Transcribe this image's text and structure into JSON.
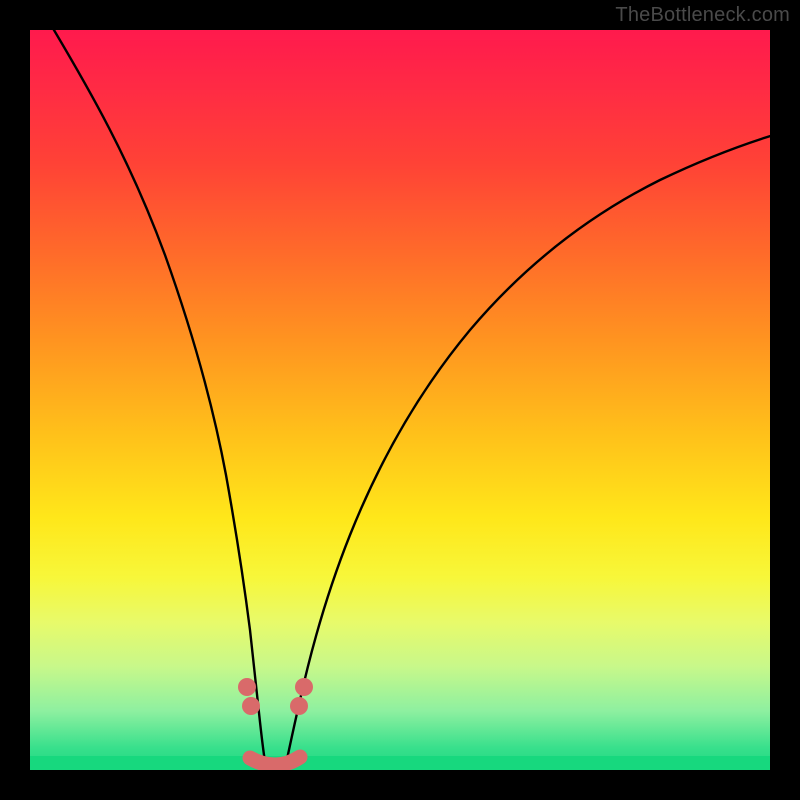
{
  "watermark": "TheBottleneck.com",
  "chart_data": {
    "type": "line",
    "title": "",
    "xlabel": "",
    "ylabel": "",
    "xlim": [
      0,
      10
    ],
    "ylim": [
      0,
      10
    ],
    "grid": false,
    "background_gradient": {
      "top_color": "#ff1a4d",
      "mid_colors": [
        "#ff6a2a",
        "#ffc21a",
        "#f7f73a"
      ],
      "bottom_color": "#17d87e",
      "orientation": "vertical"
    },
    "series": [
      {
        "name": "left-curve",
        "x": [
          0.2,
          0.6,
          1.0,
          1.4,
          1.8,
          2.05,
          2.28,
          2.45,
          2.58,
          2.66,
          2.72,
          2.78,
          2.86,
          2.92
        ],
        "values": [
          10.0,
          9.2,
          8.2,
          7.0,
          5.5,
          4.2,
          3.0,
          2.0,
          1.3,
          0.85,
          0.55,
          0.35,
          0.18,
          0.09
        ]
      },
      {
        "name": "right-curve",
        "x": [
          3.1,
          3.2,
          3.3,
          3.45,
          3.65,
          3.95,
          4.3,
          4.8,
          5.4,
          6.1,
          6.9,
          7.8,
          8.8,
          9.9,
          10.0
        ],
        "values": [
          0.09,
          0.2,
          0.4,
          0.7,
          1.1,
          1.7,
          2.35,
          3.1,
          3.85,
          4.55,
          5.2,
          5.75,
          6.25,
          6.65,
          6.7
        ]
      }
    ],
    "markers": [
      {
        "series": "left-curve",
        "x": 2.62,
        "y": 1.08,
        "color": "#d96a6a",
        "size": 14
      },
      {
        "series": "left-curve",
        "x": 2.68,
        "y": 0.88,
        "color": "#d96a6a",
        "size": 14
      },
      {
        "series": "right-curve",
        "x": 3.26,
        "y": 0.88,
        "color": "#d96a6a",
        "size": 14
      },
      {
        "series": "right-curve",
        "x": 3.32,
        "y": 1.05,
        "color": "#d96a6a",
        "size": 14
      }
    ],
    "bottom_segment": {
      "color": "#d96a6a",
      "points_x": [
        2.78,
        2.88,
        3.0,
        3.12,
        3.22,
        3.32
      ],
      "points_y": [
        0.08,
        0.04,
        0.03,
        0.04,
        0.06,
        0.1
      ],
      "stroke_width": 14
    }
  }
}
